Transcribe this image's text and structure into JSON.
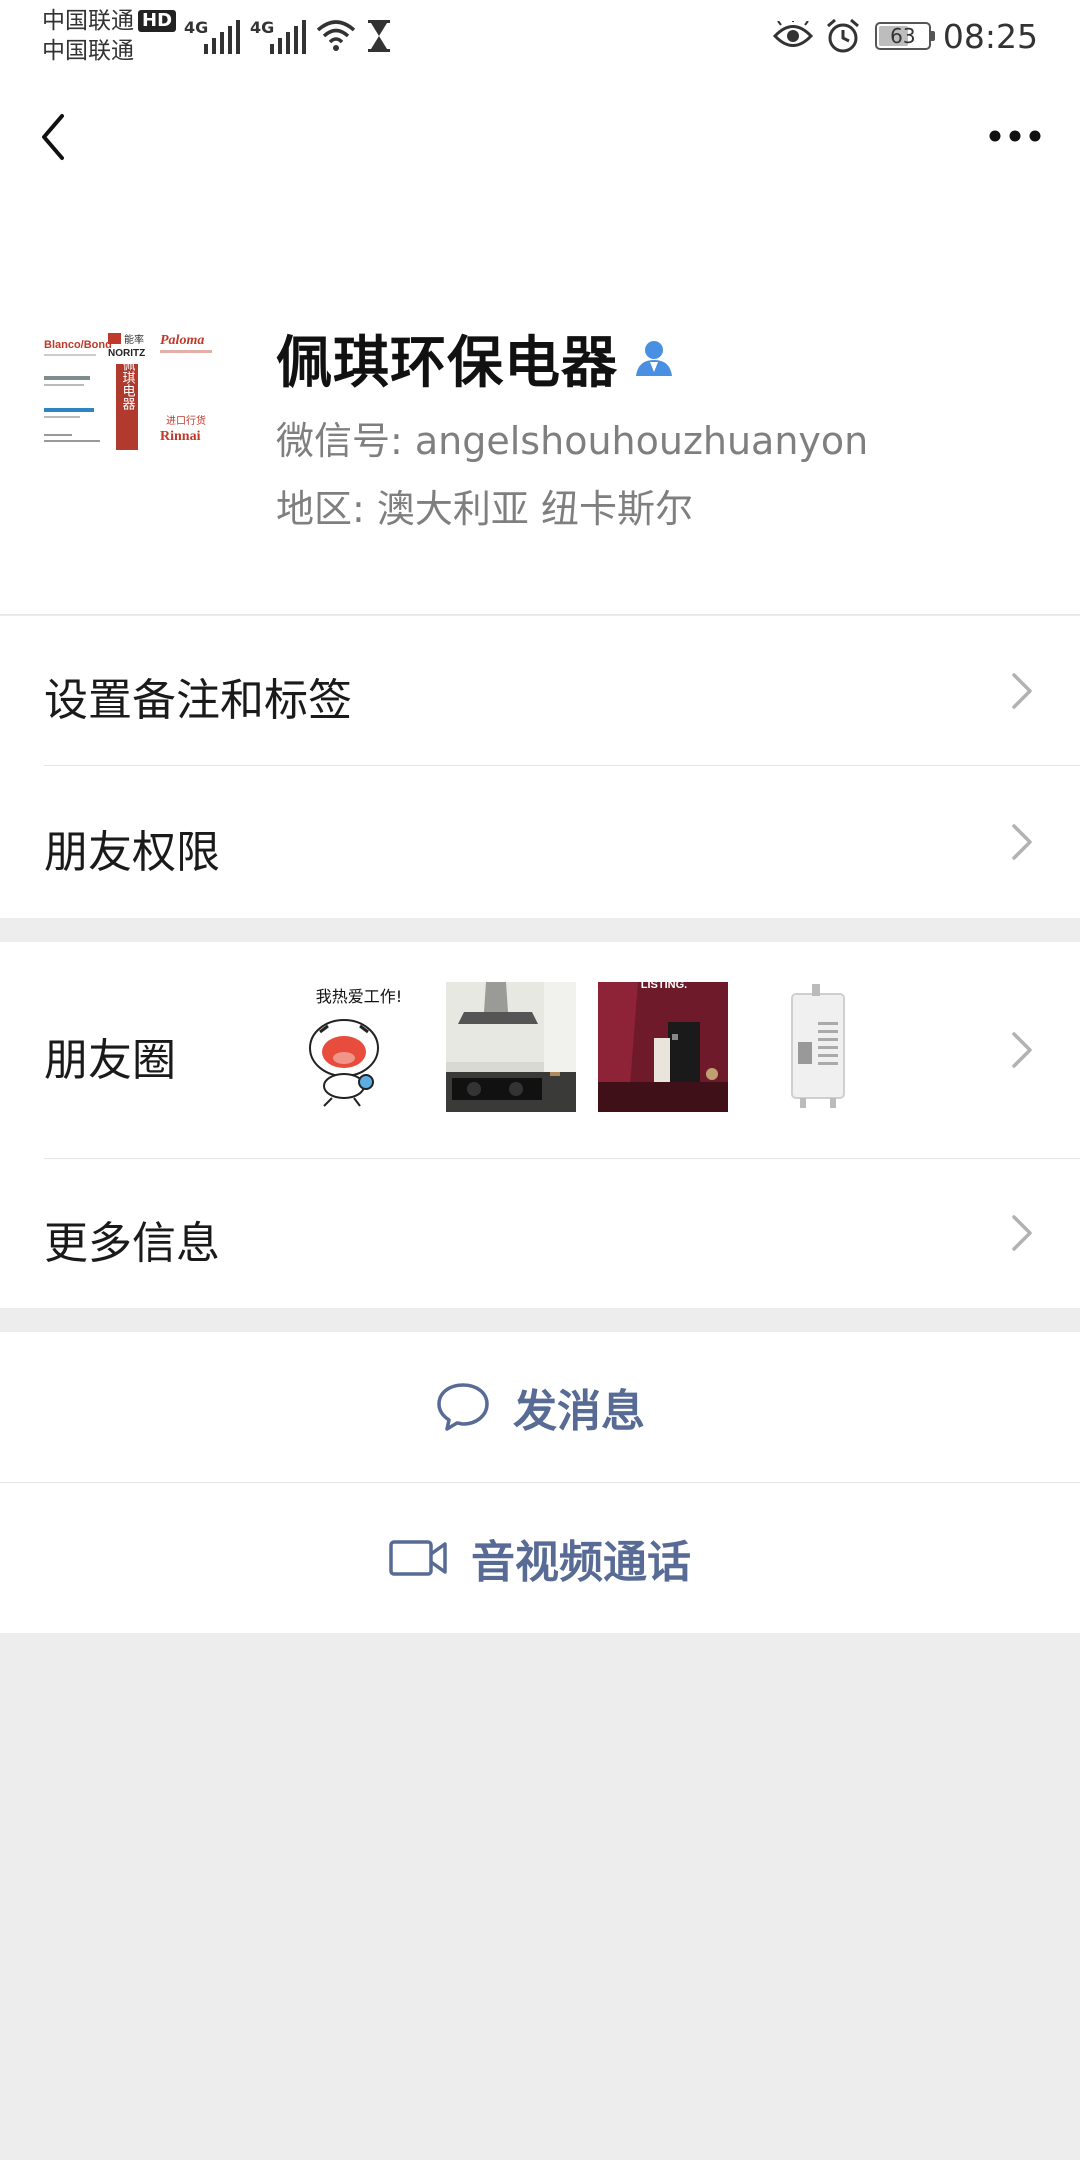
{
  "status_bar": {
    "carrier_1": "中国联通",
    "carrier_1_badge": "HD",
    "carrier_2": "中国联通",
    "network_1": "4G",
    "network_2": "4G",
    "battery_level": "63",
    "battery_fraction": 0.63,
    "time": "08:25"
  },
  "nav": {
    "back_icon": "chevron-left-icon",
    "more_icon": "ellipsis-icon"
  },
  "profile": {
    "name": "佩琪环保电器",
    "badge_icon": "person-icon",
    "badge_color": "#4a90e2",
    "wechat_id": "微信号: angelshouhouzhuanyon",
    "region": "地区: 澳大利亚 纽卡斯尔",
    "avatar_logos": {
      "left_brand_1": "Blanco/Bond",
      "top_middle_cn": "能率",
      "top_middle_en": "NORITZ",
      "top_right": "Paloma",
      "center_vertical": "佩琪电器",
      "lower_right_cn": "进口行货",
      "lower_right_en": "Rinnai"
    }
  },
  "menu": {
    "remark_tags": "设置备注和标签",
    "friend_permissions": "朋友权限",
    "moments": "朋友圈",
    "moments_sticker_text": "我热爱工作!",
    "moments_thumb_3_text": "LISTING.",
    "more_info": "更多信息"
  },
  "actions": {
    "send_message": "发消息",
    "send_message_icon": "chat-bubble-icon",
    "av_call": "音视频通话",
    "av_call_icon": "video-camera-icon",
    "link_color": "#576b95"
  }
}
